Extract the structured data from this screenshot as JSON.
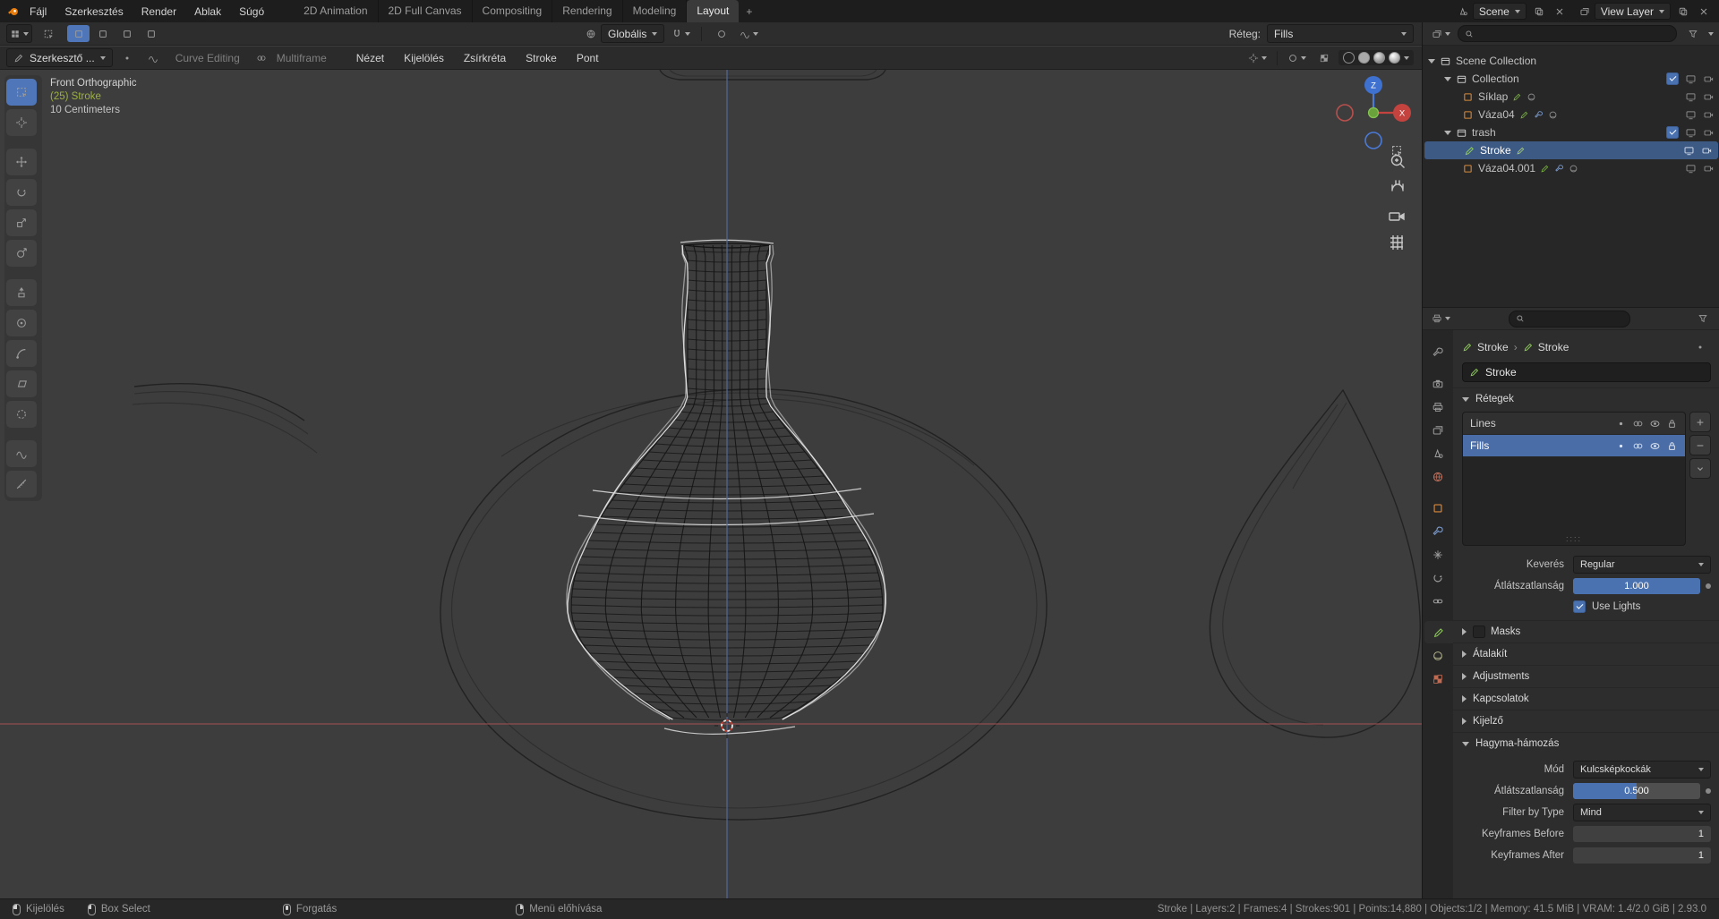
{
  "colors": {
    "accent": "#4a72b0",
    "selection": "#3d5a85",
    "active_tool": "#4f76b8",
    "axis_x": "#9c4f4f",
    "axis_z": "#55699c",
    "object_data_green": "#7ec850",
    "object_orange": "#d98a3d"
  },
  "topbar": {
    "menus": [
      "Fájl",
      "Szerkesztés",
      "Render",
      "Ablak",
      "Súgó"
    ],
    "workspaces": [
      "2D Animation",
      "2D Full Canvas",
      "Compositing",
      "Rendering",
      "Modeling",
      "Layout"
    ],
    "new_workspace_label": "+",
    "scene_label": "Scene",
    "view_layer_label": "View Layer"
  },
  "tool_settings": {
    "orientation_label": "Globális",
    "layer_label": "Réteg:",
    "layer_value": "Fills"
  },
  "viewport_header": {
    "mode_label": "Szerkesztő ...",
    "curve_editing_label": "Curve Editing",
    "multiframe_label": "Multiframe",
    "menus": [
      "Nézet",
      "Kijelölés",
      "Zsírkréta",
      "Stroke",
      "Pont"
    ]
  },
  "viewport": {
    "view_label": "Front Orthographic",
    "object_label": "(25) Stroke",
    "scale_label": "10 Centimeters",
    "gizmo": {
      "z_label": "Z",
      "x_label": "X"
    }
  },
  "outliner": {
    "root_label": "Scene Collection",
    "items": [
      {
        "label": "Collection"
      },
      {
        "label": "Síklap"
      },
      {
        "label": "Váza04"
      },
      {
        "label": "trash"
      },
      {
        "label": "Stroke"
      },
      {
        "label": "Váza04.001"
      }
    ]
  },
  "properties": {
    "breadcrumb_object": "Stroke",
    "breadcrumb_data": "Stroke",
    "name_value": "Stroke",
    "layers_panel": {
      "title": "Rétegek",
      "rows": [
        {
          "name": "Lines"
        },
        {
          "name": "Fills"
        }
      ],
      "blend_label": "Keverés",
      "blend_value": "Regular",
      "opacity_label": "Átlátszatlanság",
      "opacity_value": "1.000",
      "use_lights_label": "Use Lights"
    },
    "collapsed_panels": [
      "Masks",
      "Átalakít",
      "Adjustments",
      "Kapcsolatok",
      "Kijelző"
    ],
    "onion_panel": {
      "title": "Hagyma-hámozás",
      "mode_label": "Mód",
      "mode_value": "Kulcsképkockák",
      "opacity_label": "Átlátszatlanság",
      "opacity_value": "0.500",
      "filter_label": "Filter by Type",
      "filter_value": "Mind",
      "before_label": "Keyframes Before",
      "before_value": "1",
      "after_label": "Keyframes After",
      "after_value": "1"
    }
  },
  "statusbar": {
    "items": [
      {
        "label": "Kijelölés"
      },
      {
        "label": "Box Select"
      },
      {
        "label": "Forgatás"
      },
      {
        "label": "Menü előhívása"
      }
    ],
    "stats": "Stroke | Layers:2 | Frames:4 | Strokes:901 | Points:14,880 | Objects:1/2 | Memory: 41.5 MiB | VRAM: 1.4/2.0 GiB | 2.93.0"
  }
}
